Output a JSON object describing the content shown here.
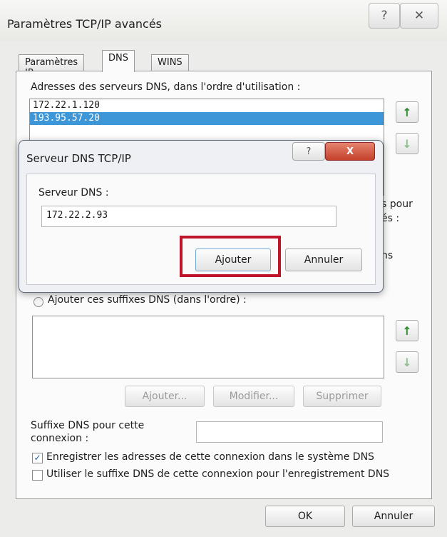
{
  "window": {
    "title": "Paramètres TCP/IP avancés",
    "help_glyph": "?",
    "close_glyph": "✕"
  },
  "tabs": [
    {
      "label": "Paramètres IP",
      "active": false
    },
    {
      "label": "DNS",
      "active": true
    },
    {
      "label": "WINS",
      "active": false
    }
  ],
  "dns_servers": {
    "label": "Adresses des serveurs DNS, dans l'ordre d'utilisation :",
    "items": [
      "172.22.1.120",
      "193.95.57.20"
    ],
    "selected_index": 1
  },
  "hidden_text": {
    "fragment1": "s pour",
    "fragment2": "és :",
    "fragment3": "ns"
  },
  "suffix_radio": {
    "label": "Ajouter ces suffixes DNS (dans l'ordre) :"
  },
  "suffix_buttons": {
    "add": "Ajouter...",
    "modify": "Modifier...",
    "delete": "Supprimer"
  },
  "connection_suffix": {
    "label_line1": "Suffixe DNS pour cette",
    "label_line2": "connexion :",
    "value": ""
  },
  "checkboxes": {
    "register": {
      "label": "Enregistrer les adresses de cette connexion dans le système DNS",
      "checked": true
    },
    "use_suffix": {
      "label": "Utiliser le suffixe DNS de cette connexion pour l'enregistrement DNS",
      "checked": false
    }
  },
  "footer": {
    "ok": "OK",
    "cancel": "Annuler"
  },
  "dialog": {
    "title": "Serveur DNS TCP/IP",
    "help_glyph": "?",
    "close_glyph": "X",
    "field_label": "Serveur DNS :",
    "field_value": "172.22.2.93",
    "add_button": "Ajouter",
    "cancel_button": "Annuler"
  },
  "icons": {
    "up": "↑",
    "down": "↓"
  }
}
